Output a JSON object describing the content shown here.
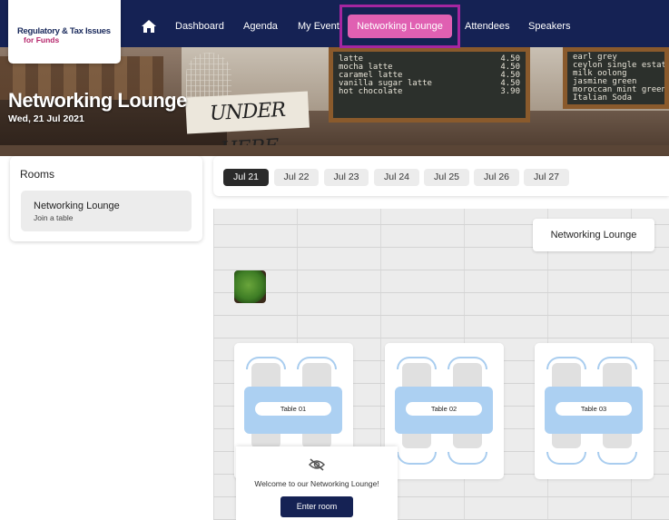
{
  "logo": {
    "line1": "Regulatory & Tax Issues",
    "line2": "for Funds"
  },
  "nav": {
    "items": [
      "Dashboard",
      "Agenda",
      "My Event",
      "Networking Lounge",
      "Attendees",
      "Speakers"
    ],
    "active": "Networking Lounge"
  },
  "banner": {
    "title": "Networking Lounge",
    "date": "Wed, 21 Jul 2021",
    "sign_text": "UNDER HERE",
    "chalkboard_left": [
      [
        "latte",
        "4.50"
      ],
      [
        "mocha latte",
        "4.50"
      ],
      [
        "caramel latte",
        "4.50"
      ],
      [
        "vanilla sugar latte",
        "4.50"
      ],
      [
        "hot chocolate",
        "3.90"
      ]
    ],
    "chalkboard_right": [
      "earl grey",
      "ceylon single estate",
      "milk oolong",
      "jasmine green",
      "moroccan mint green",
      "Italian Soda"
    ]
  },
  "rooms": {
    "title": "Rooms",
    "items": [
      {
        "name": "Networking Lounge",
        "subtitle": "Join a table"
      }
    ]
  },
  "date_tabs": {
    "items": [
      "Jul 21",
      "Jul 22",
      "Jul 23",
      "Jul 24",
      "Jul 25",
      "Jul 26",
      "Jul 27"
    ],
    "active": "Jul 21"
  },
  "lounge": {
    "label": "Networking Lounge",
    "tables": [
      "Table 01",
      "Table 02",
      "Table 03"
    ]
  },
  "welcome": {
    "message": "Welcome to our Networking Lounge!",
    "button_label": "Enter room"
  },
  "icons": {
    "home": "home-icon",
    "eye_off": "eye-off-icon",
    "plant": "plant-icon"
  },
  "colors": {
    "nav_bg": "#152254",
    "active_nav": "#e060b2",
    "highlight_border": "#a526a0",
    "table_blue": "#acd0f2"
  }
}
